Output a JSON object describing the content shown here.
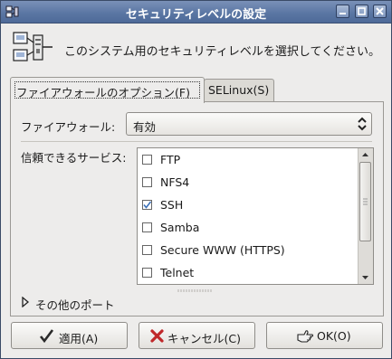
{
  "window": {
    "title": "セキュリティレベルの設定"
  },
  "header": {
    "text": "このシステム用のセキュリティレベルを選択してください。"
  },
  "tabs": [
    {
      "label": "ファイアウォールのオプション(F)",
      "active": true
    },
    {
      "label": "SELinux(S)",
      "active": false
    }
  ],
  "firewall": {
    "label": "ファイアウォール:",
    "value": "有効"
  },
  "services": {
    "label": "信頼できるサービス:",
    "items": [
      {
        "name": "FTP",
        "checked": false
      },
      {
        "name": "NFS4",
        "checked": false
      },
      {
        "name": "SSH",
        "checked": true
      },
      {
        "name": "Samba",
        "checked": false
      },
      {
        "name": "Secure WWW (HTTPS)",
        "checked": false
      },
      {
        "name": "Telnet",
        "checked": false
      }
    ]
  },
  "other_ports": {
    "label": "その他のポート"
  },
  "buttons": {
    "apply": "適用(A)",
    "cancel": "キャンセル(C)",
    "ok": "OK(O)"
  },
  "colors": {
    "titlebar": "#5b77a4",
    "window_bg": "#edeceb",
    "check_mark": "#3a6fb8",
    "cancel_x": "#c0282a"
  },
  "icons": [
    "window-menu-icon",
    "minimize-icon",
    "maximize-icon",
    "close-icon",
    "security-computers-icon",
    "checkmark-icon",
    "cancel-x-icon",
    "ok-hand-icon",
    "expander-arrow-icon"
  ]
}
